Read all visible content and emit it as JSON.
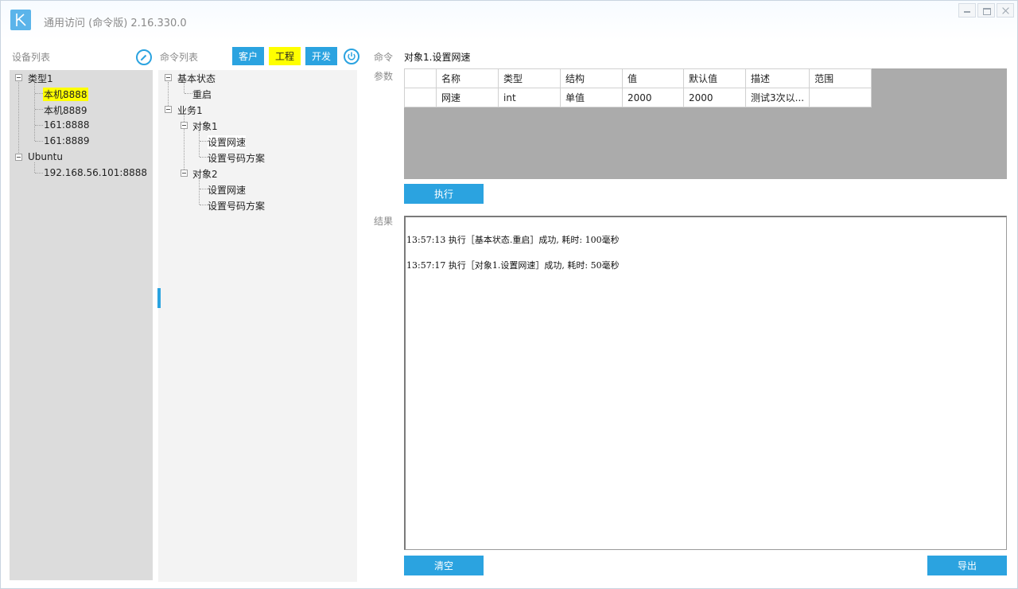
{
  "window": {
    "title": "通用访问 (命令版) 2.16.330.0",
    "accent": "#2ba3e0",
    "highlight": "#ffff00"
  },
  "device_panel": {
    "label": "设备列表",
    "groups": [
      {
        "name": "类型1",
        "items": [
          "本机8888",
          "本机8889",
          "161:8888",
          "161:8889"
        ]
      },
      {
        "name": "Ubuntu",
        "items": [
          "192.168.56.101:8888"
        ]
      }
    ],
    "selected": "本机8888"
  },
  "command_panel": {
    "label": "命令列表",
    "buttons": {
      "customer": "客户",
      "project": "工程",
      "develop": "开发"
    },
    "tree": {
      "basic": "基本状态",
      "restart": "重启",
      "biz": "业务1",
      "obj1": "对象1",
      "obj1_speed": "设置网速",
      "obj1_scheme": "设置号码方案",
      "obj2": "对象2",
      "obj2_speed": "设置网速",
      "obj2_scheme": "设置号码方案"
    }
  },
  "command": {
    "label": "命令",
    "value": "对象1.设置网速",
    "params_label": "参数",
    "columns": [
      "名称",
      "类型",
      "结构",
      "值",
      "默认值",
      "描述",
      "范围"
    ],
    "rows": [
      [
        "网速",
        "int",
        "单值",
        "2000",
        "2000",
        "测试3次以...",
        ""
      ]
    ],
    "execute": "执行"
  },
  "result": {
    "label": "结果",
    "lines": [
      "13:57:13  执行［基本状态.重启］成功, 耗时: 100毫秒",
      "13:57:17  执行［对象1.设置网速］成功, 耗时: 50毫秒"
    ],
    "clear": "清空",
    "export": "导出"
  }
}
